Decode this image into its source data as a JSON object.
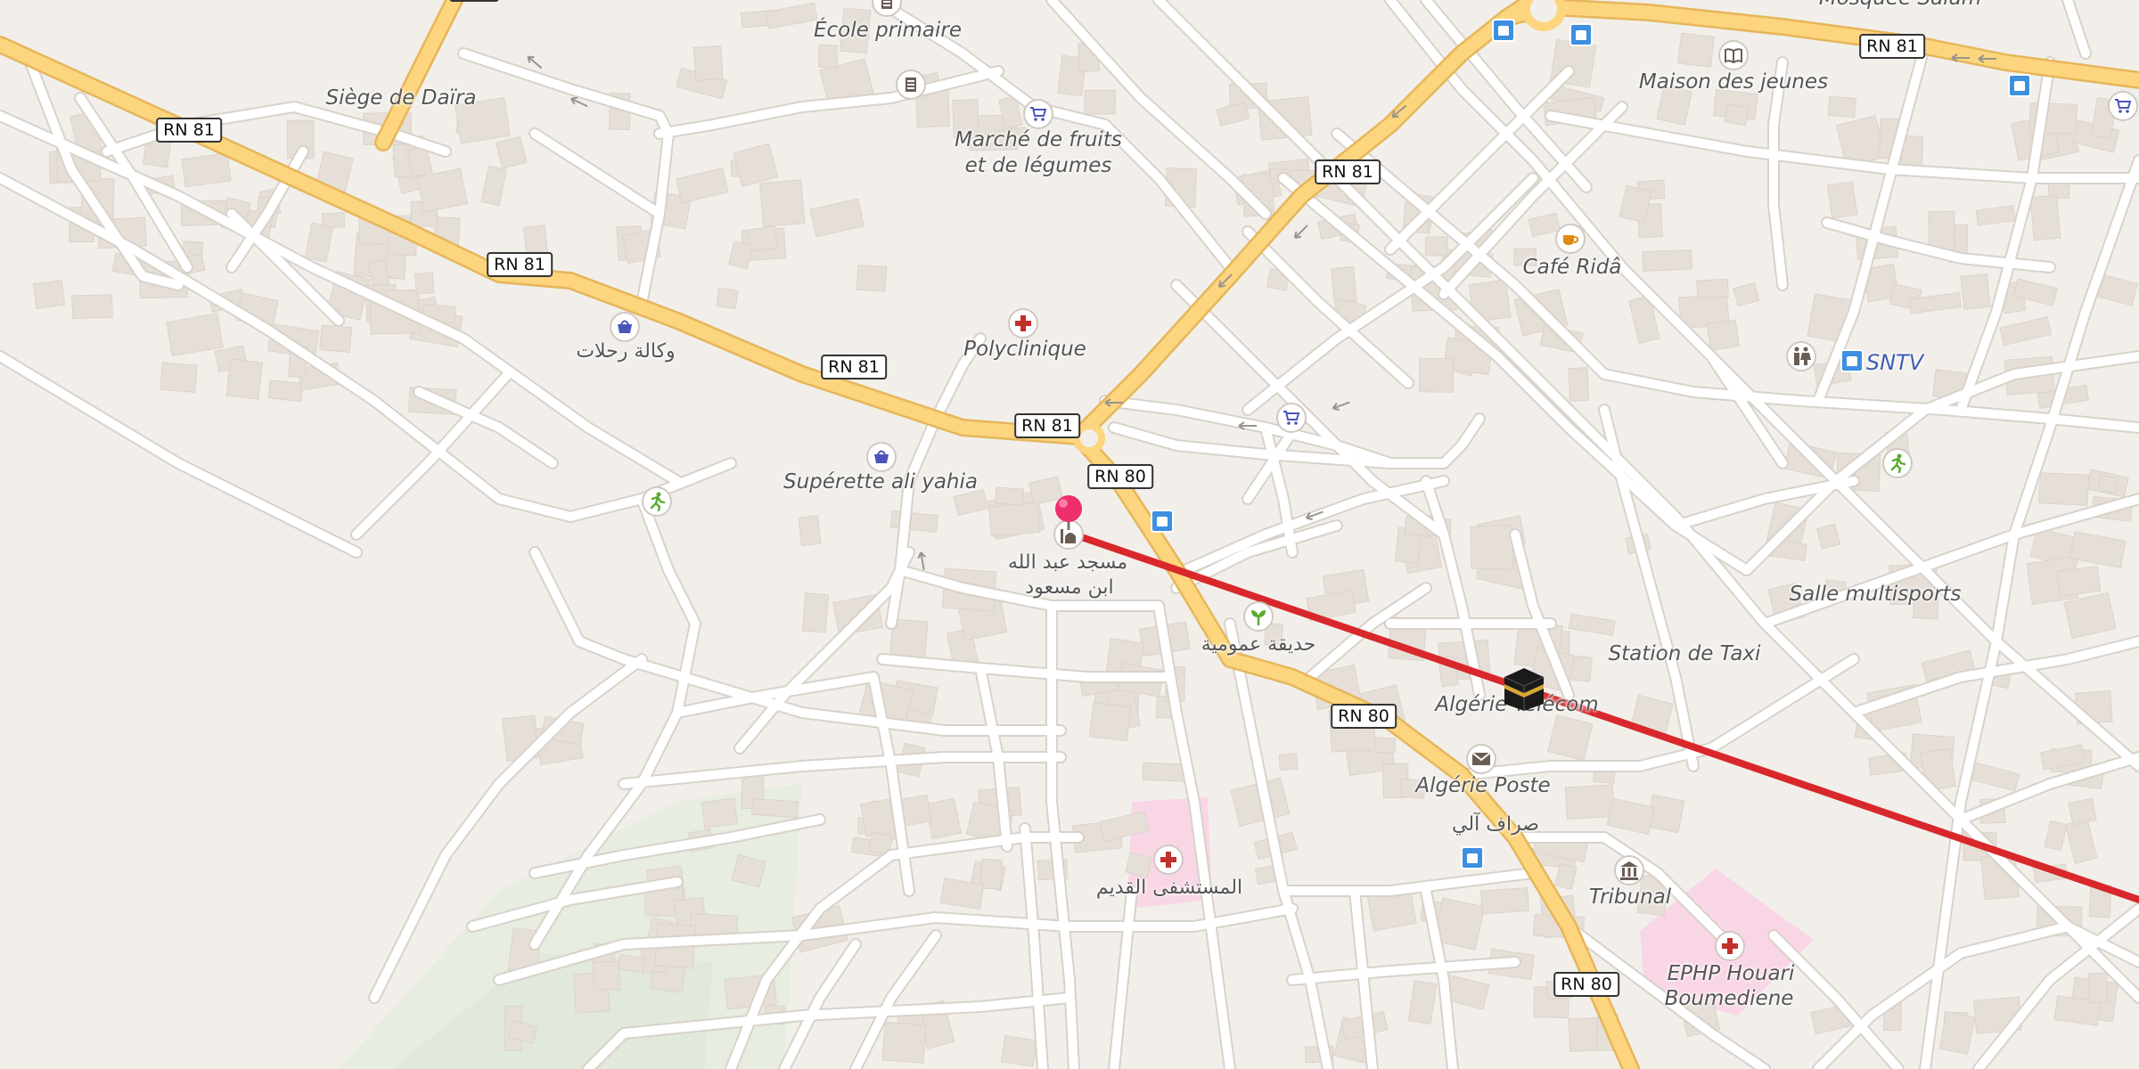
{
  "map": {
    "theme": "light",
    "colors": {
      "land": "#f2efeb",
      "building": "#e6dfd7",
      "road": "#ffffff",
      "road_casing": "#d8d2ca",
      "highway": "#fcd57e",
      "highway_casing": "#e9b85c",
      "qibla_line": "#d8282b",
      "park": "#e4ebdc",
      "hospital_area": "#f9d6e6",
      "pin": "#ee2f6d"
    },
    "road_shields": {
      "rn81_a": "RN 81",
      "rn81_b": "RN 81",
      "rn81_c": "RN 81",
      "rn81_d": "RN 81",
      "rn81_e": "RN 81",
      "rn81_f": "RN 81",
      "rn80_a": "RN 80",
      "rn80_b": "RN 80",
      "rn80_c": "RN 80"
    },
    "labels": {
      "mosque_salam": "Mosquée Salam",
      "ecole_primaire": "École primaire",
      "siege_daira": "Siège de Daïra",
      "marche_line1": "Marché de fruits",
      "marche_line2": "et de légumes",
      "maison_jeunes": "Maison des jeunes",
      "cafe_rida": "Café Ridâ",
      "wakala_rihlat": "وكالة رحلات",
      "polyclinique": "Polyclinique",
      "sntv": "SNTV",
      "superette": "Supérette ali yahia",
      "mosque_line1": "مسجد عبد الله",
      "mosque_line2": "ابن مسعود",
      "hadiqa": "حديقة عمومية",
      "salle_multisports": "Salle multisports",
      "station_taxi": "Station de Taxi",
      "algerie_telecom": "Algérie Télécom",
      "algerie_poste": "Algérie Poste",
      "sarraf": "صراف آلي",
      "tribunal": "Tribunal",
      "mustashfa": "المستشفى القديم",
      "ephp_line1": "EPHP Houari",
      "ephp_line2": "Boumediene"
    },
    "icons": {
      "cart": "shopping-cart-icon",
      "basket": "shopping-basket-icon",
      "medical": "medical-cross-icon",
      "school": "school-icon",
      "mosque": "mosque-icon",
      "book": "book-icon",
      "cafe": "cafe-cup-icon",
      "toilets": "toilets-icon",
      "sport": "sport-runner-icon",
      "garden": "garden-icon",
      "post": "mail-envelope-icon",
      "court": "courthouse-icon",
      "bus": "bus-stop-icon",
      "kaaba": "kaaba-icon",
      "pin": "location-pin-icon"
    }
  }
}
